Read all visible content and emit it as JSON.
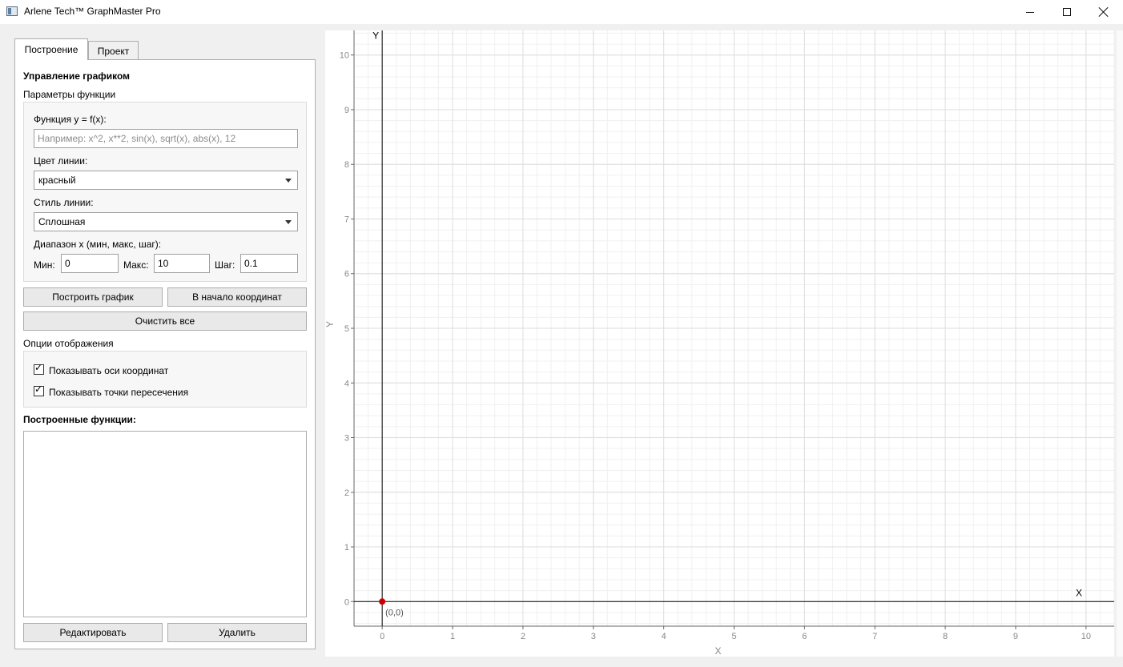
{
  "window": {
    "title": "Arlene Tech™ GraphMaster Pro"
  },
  "tabs": [
    {
      "label": "Построение",
      "active": true
    },
    {
      "label": "Проект",
      "active": false
    }
  ],
  "panel": {
    "heading": "Управление графиком",
    "function_params": {
      "title": "Параметры функции",
      "function_label": "Функция y = f(x):",
      "function_value": "",
      "function_placeholder": "Например: x^2, x**2, sin(x), sqrt(x), abs(x), 12",
      "color_label": "Цвет линии:",
      "color_value": "красный",
      "style_label": "Стиль линии:",
      "style_value": "Сплошная",
      "range_label": "Диапазон x (мин, макс, шаг):",
      "min_label": "Мин:",
      "min_value": "0",
      "max_label": "Макс:",
      "max_value": "10",
      "step_label": "Шаг:",
      "step_value": "0.1"
    },
    "buttons": {
      "plot": "Построить график",
      "origin": "В начало координат",
      "clear": "Очистить все",
      "edit": "Редактировать",
      "delete": "Удалить"
    },
    "display_options": {
      "title": "Опции отображения",
      "show_axes": {
        "label": "Показывать оси координат",
        "checked": true
      },
      "show_intersections": {
        "label": "Показывать точки пересечения",
        "checked": true
      }
    },
    "functions_list": {
      "title": "Построенные функции:",
      "items": []
    }
  },
  "plot": {
    "x_axis_label": "X",
    "y_axis_label": "Y",
    "x_axis_end_label": "X",
    "y_axis_end_label": "Y",
    "origin_label": "(0,0)",
    "x_ticks": [
      "0",
      "1",
      "2",
      "3",
      "4",
      "5",
      "6",
      "7",
      "8",
      "9",
      "10"
    ],
    "y_ticks": [
      "0",
      "1",
      "2",
      "3",
      "4",
      "5",
      "6",
      "7",
      "8",
      "9",
      "10"
    ],
    "xlim": [
      -0.4,
      10.4
    ],
    "ylim": [
      -0.45,
      10.45
    ],
    "grid": true,
    "origin_point_color": "#cc0000",
    "axis_color": "#000000"
  }
}
